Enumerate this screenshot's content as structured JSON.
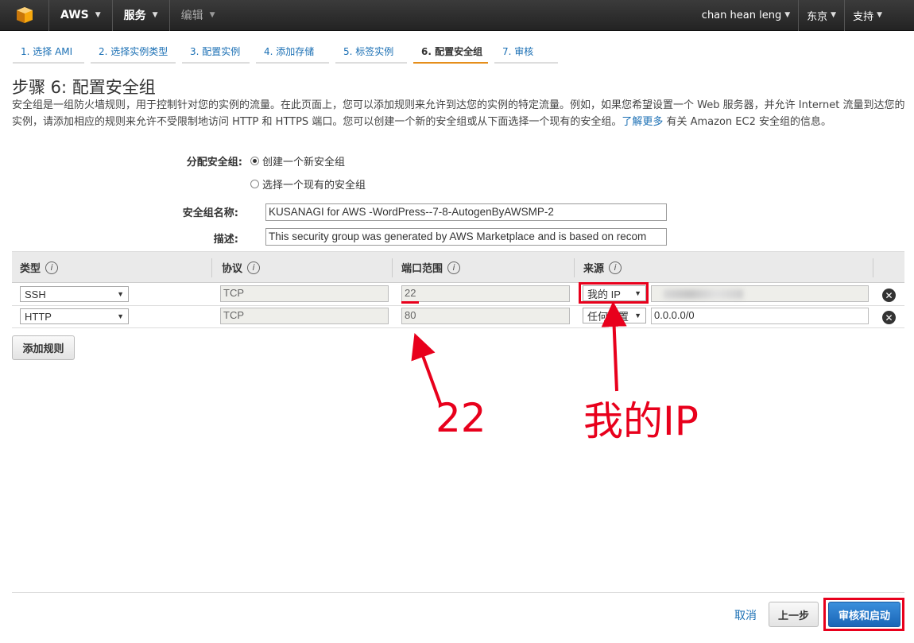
{
  "nav": {
    "brand": "AWS",
    "services": "服务",
    "edit": "编辑",
    "user": "chan hean leng",
    "region": "东京",
    "support": "支持"
  },
  "tabs": [
    {
      "label": "1. 选择 AMI"
    },
    {
      "label": "2. 选择实例类型"
    },
    {
      "label": "3. 配置实例"
    },
    {
      "label": "4. 添加存储"
    },
    {
      "label": "5. 标签实例"
    },
    {
      "label": "6. 配置安全组"
    },
    {
      "label": "7. 审核"
    }
  ],
  "page": {
    "title": "步骤 6: 配置安全组",
    "description": "安全组是一组防火墙规则，用于控制针对您的实例的流量。在此页面上，您可以添加规则来允许到达您的实例的特定流量。例如，如果您希望设置一个 Web 服务器，并允许 Internet 流量到达您的实例，请添加相应的规则来允许不受限制地访问 HTTP 和 HTTPS 端口。您可以创建一个新的安全组或从下面选择一个现有的安全组。",
    "learn_more": "了解更多",
    "description_tail": " 有关 Amazon EC2 安全组的信息。"
  },
  "form": {
    "assign_label": "分配安全组:",
    "create_new": "创建一个新安全组",
    "select_existing": "选择一个现有的安全组",
    "name_label": "安全组名称:",
    "name_value": "KUSANAGI for AWS -WordPress--7-8-AutogenByAWSMP-2",
    "desc_label": "描述:",
    "desc_value": "This security group was generated by AWS Marketplace and is based on recom"
  },
  "table": {
    "headers": {
      "type": "类型",
      "protocol": "协议",
      "port": "端口范围",
      "source": "来源"
    },
    "info_glyph": "i",
    "rows": [
      {
        "type": "SSH",
        "protocol": "TCP",
        "port": "22",
        "source": "我的 IP",
        "cidr": ""
      },
      {
        "type": "HTTP",
        "protocol": "TCP",
        "port": "80",
        "source": "任何位置",
        "cidr": "0.0.0.0/0"
      }
    ],
    "add_rule": "添加规则"
  },
  "footer": {
    "cancel": "取消",
    "previous": "上一步",
    "review_launch": "审核和启动"
  },
  "annotations": {
    "port_label": "22",
    "ip_label": "我的IP"
  },
  "colors": {
    "accent": "#e58e1a",
    "link": "#1a6fb4",
    "annotation": "#e8001c",
    "primary": "#1a66b7"
  }
}
